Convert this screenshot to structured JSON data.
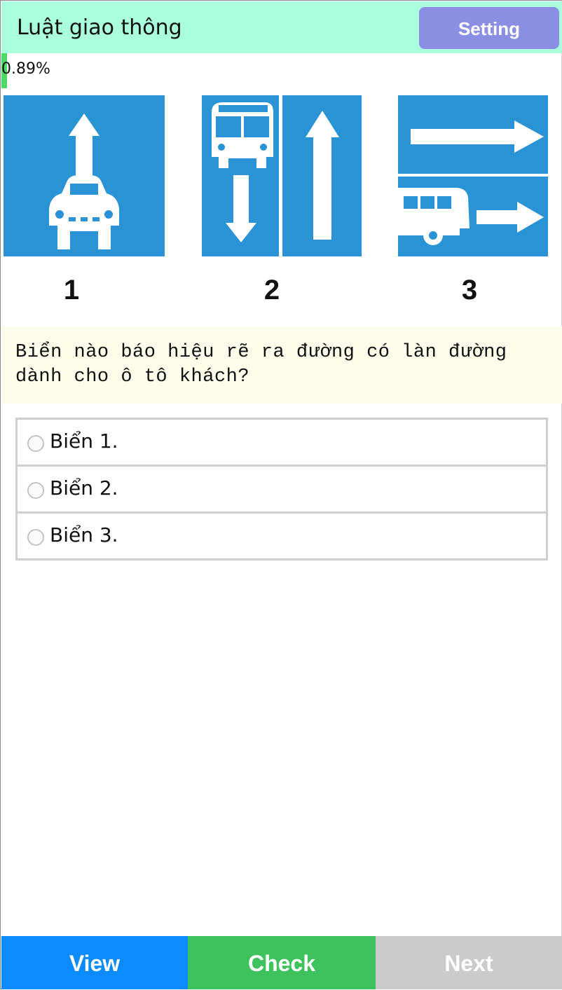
{
  "header": {
    "title": "Luật giao thông",
    "setting_label": "Setting",
    "bg_color": "#aaffdd",
    "setting_color": "#8a8fe4"
  },
  "progress": {
    "text": "0.89%",
    "value_percent": 0.89,
    "bar_color": "#4cd964"
  },
  "signs": {
    "labels": [
      "1",
      "2",
      "3"
    ],
    "sign_color": "#2a93d5"
  },
  "question": {
    "text": "Biển nào báo hiệu rẽ ra đường có làn đường dành cho ô tô khách?"
  },
  "options": [
    {
      "label": "Biển 1."
    },
    {
      "label": "Biển 2."
    },
    {
      "label": "Biển 3."
    }
  ],
  "footer": {
    "view_label": "View",
    "check_label": "Check",
    "next_label": "Next",
    "view_color": "#0b8bff",
    "check_color": "#3dc25e",
    "next_color": "#cbcbcb"
  }
}
